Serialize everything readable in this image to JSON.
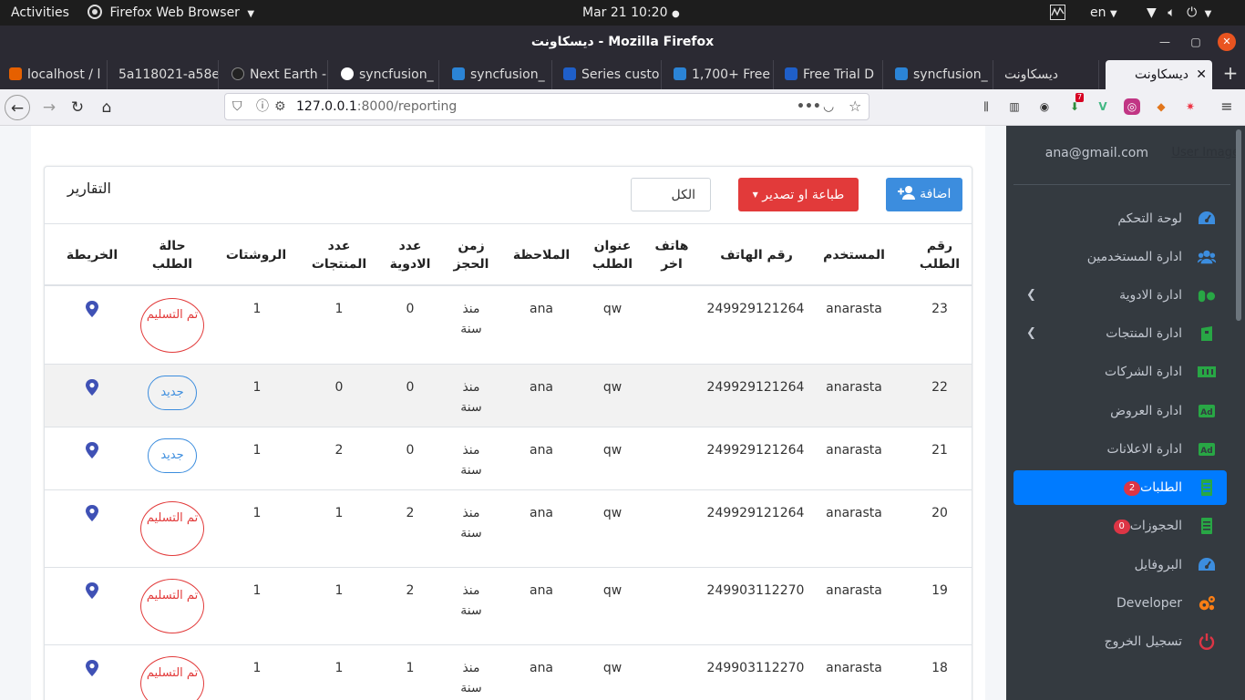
{
  "system_bar": {
    "activities": "Activities",
    "app": "Firefox Web Browser",
    "clock": "Mar 21  10:20",
    "lang": "en"
  },
  "window": {
    "title": "ديسكاونت - Mozilla Firefox"
  },
  "tabs": [
    {
      "label": "localhost / l",
      "color": "#e66000"
    },
    {
      "label": "5a118021-a58e",
      "color": ""
    },
    {
      "label": "Next Earth -",
      "color": "#222222"
    },
    {
      "label": "syncfusion_",
      "color": "#4285f4"
    },
    {
      "label": "syncfusion_",
      "color": "#2b84d6"
    },
    {
      "label": "Series custo",
      "color": "#1f5fc9"
    },
    {
      "label": "1,700+ Free",
      "color": "#2b84d6"
    },
    {
      "label": "Free Trial D",
      "color": "#1f5fc9"
    },
    {
      "label": "syncfusion_",
      "color": "#2b84d6"
    },
    {
      "label": "ديسكاونت",
      "color": ""
    },
    {
      "label": "ديسكاونت",
      "color": "",
      "active": true
    }
  ],
  "url": {
    "host": "127.0.0.1",
    "rest": ":8000/reporting",
    "ext_badge": "7"
  },
  "card": {
    "title": "التقارير",
    "add_label": "اضافة",
    "print_label": "طباعة او تصدير",
    "filter_value": "الكل"
  },
  "table": {
    "headers": [
      "رقم الطلب",
      "المستخدم",
      "رقم الهاتف",
      "هاتف اخر",
      "عنوان الطلب",
      "الملاحظة",
      "زمن الحجز",
      "عدد الادوية",
      "عدد المنتجات",
      "الروشتات",
      "حالة الطلب",
      "الخريطة"
    ],
    "rows": [
      {
        "id": "23",
        "user": "anarasta",
        "phone": "249929121264",
        "phone2": "",
        "address": "qw",
        "note": "ana",
        "time": "منذ سنة",
        "meds": "0",
        "products": "1",
        "prescriptions": "1",
        "status": "تم التسليم",
        "status_type": "delivered"
      },
      {
        "id": "22",
        "user": "anarasta",
        "phone": "249929121264",
        "phone2": "",
        "address": "qw",
        "note": "ana",
        "time": "منذ سنة",
        "meds": "0",
        "products": "0",
        "prescriptions": "1",
        "status": "جديد",
        "status_type": "new"
      },
      {
        "id": "21",
        "user": "anarasta",
        "phone": "249929121264",
        "phone2": "",
        "address": "qw",
        "note": "ana",
        "time": "منذ سنة",
        "meds": "0",
        "products": "2",
        "prescriptions": "1",
        "status": "جديد",
        "status_type": "new"
      },
      {
        "id": "20",
        "user": "anarasta",
        "phone": "249929121264",
        "phone2": "",
        "address": "qw",
        "note": "ana",
        "time": "منذ سنة",
        "meds": "2",
        "products": "1",
        "prescriptions": "1",
        "status": "تم التسليم",
        "status_type": "delivered"
      },
      {
        "id": "19",
        "user": "anarasta",
        "phone": "249903112270",
        "phone2": "",
        "address": "qw",
        "note": "ana",
        "time": "منذ سنة",
        "meds": "2",
        "products": "1",
        "prescriptions": "1",
        "status": "تم التسليم",
        "status_type": "delivered"
      },
      {
        "id": "18",
        "user": "anarasta",
        "phone": "249903112270",
        "phone2": "",
        "address": "qw",
        "note": "ana",
        "time": "منذ سنة",
        "meds": "1",
        "products": "1",
        "prescriptions": "1",
        "status": "تم التسليم",
        "status_type": "delivered"
      }
    ]
  },
  "sidebar": {
    "email": "ana@gmail.com",
    "user_image_alt": "User Image",
    "items": [
      {
        "label": "لوحة التحكم",
        "icon": "dashboard-icon",
        "icon_color": "#3c8dde"
      },
      {
        "label": "ادارة المستخدمين",
        "icon": "users-icon",
        "icon_color": "#3c8dde"
      },
      {
        "label": "ادارة الادوية",
        "icon": "pills-icon",
        "icon_color": "#28a745",
        "chevron": true
      },
      {
        "label": "ادارة المنتجات",
        "icon": "product-icon",
        "icon_color": "#28a745",
        "chevron": true
      },
      {
        "label": "ادارة الشركات",
        "icon": "company-icon",
        "icon_color": "#28a745"
      },
      {
        "label": "ادارة العروض",
        "icon": "ad-icon",
        "icon_color": "#28a745"
      },
      {
        "label": "ادارة الاعلانات",
        "icon": "ad-icon",
        "icon_color": "#28a745"
      },
      {
        "label": "الطلبات",
        "icon": "orders-icon",
        "icon_color": "#28a745",
        "badge": "2",
        "active": true
      },
      {
        "label": "الحجوزات",
        "icon": "bookings-icon",
        "icon_color": "#28a745",
        "badge": "0"
      },
      {
        "label": "البروفايل",
        "icon": "profile-icon",
        "icon_color": "#3c8dde"
      },
      {
        "label": "Developer",
        "icon": "gears-icon",
        "icon_color": "#fd7e14"
      },
      {
        "label": "تسجيل الخروج",
        "icon": "power-icon",
        "icon_color": "#dc3545"
      }
    ]
  }
}
